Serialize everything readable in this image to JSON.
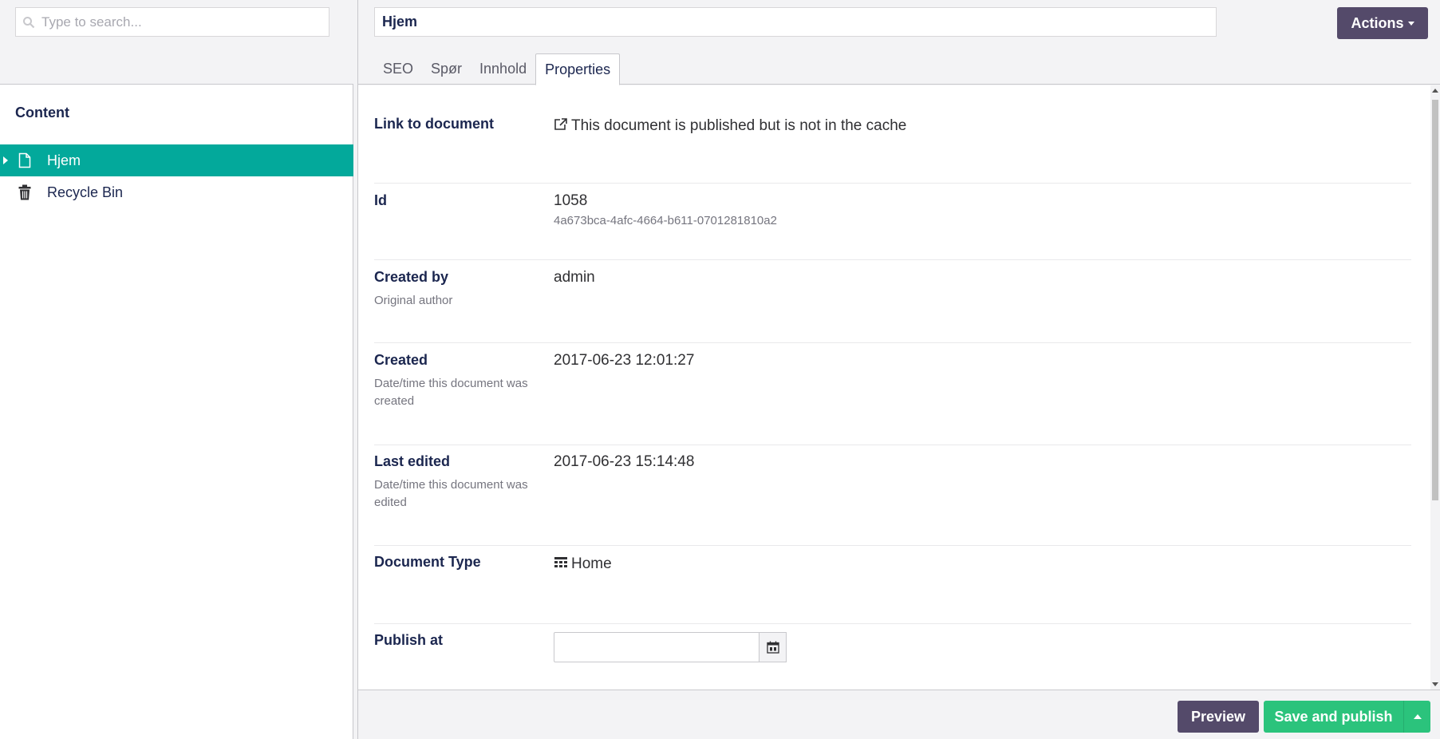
{
  "tree": {
    "search_placeholder": "Type to search...",
    "root_label": "Content",
    "items": [
      {
        "label": "Hjem",
        "icon": "document-icon",
        "selected": true
      },
      {
        "label": "Recycle Bin",
        "icon": "trash-icon",
        "selected": false
      }
    ]
  },
  "editor": {
    "name_value": "Hjem",
    "actions_label": "Actions",
    "tabs": [
      {
        "label": "SEO"
      },
      {
        "label": "Spør"
      },
      {
        "label": "Innhold"
      },
      {
        "label": "Properties"
      }
    ],
    "active_tab": "Properties",
    "properties": {
      "link": {
        "title": "Link to document",
        "value": "This document is published but is not in the cache"
      },
      "id": {
        "title": "Id",
        "value": "1058",
        "guid": "4a673bca-4afc-4664-b611-0701281810a2"
      },
      "created_by": {
        "title": "Created by",
        "desc": "Original author",
        "value": "admin"
      },
      "created": {
        "title": "Created",
        "desc": "Date/time this document was created",
        "value": "2017-06-23 12:01:27"
      },
      "last_edited": {
        "title": "Last edited",
        "desc": "Date/time this document was edited",
        "value": "2017-06-23 15:14:48"
      },
      "doc_type": {
        "title": "Document Type",
        "value": "Home"
      },
      "publish_at": {
        "title": "Publish at",
        "value": ""
      }
    }
  },
  "footer": {
    "preview_label": "Preview",
    "save_label": "Save and publish"
  },
  "colors": {
    "accent": "#03a99b",
    "primary_button": "#544a6a",
    "success_button": "#2bc37c"
  }
}
